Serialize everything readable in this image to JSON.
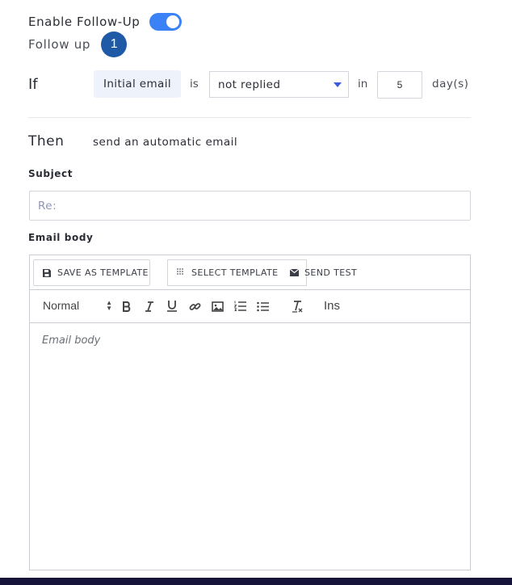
{
  "enable_followup": {
    "label": "Enable Follow-Up",
    "toggle_on": true,
    "accent": "#3b82f6"
  },
  "follow_up": {
    "label": "Follow up",
    "step": "1",
    "badge_color": "#1f5aa6"
  },
  "condition": {
    "if_label": "If",
    "trigger": "Initial email",
    "is_label": "is",
    "status_selected": "not replied",
    "in_label": "in",
    "days_value": "5",
    "days_unit": "day(s)"
  },
  "action": {
    "then_label": "Then",
    "text": "send an automatic email"
  },
  "subject": {
    "label": "Subject",
    "placeholder": "Re:"
  },
  "email_body": {
    "label": "Email body",
    "toolbar": {
      "save_template": "SAVE AS TEMPLATE",
      "select_template": "SELECT TEMPLATE",
      "send_test": "SEND TEST"
    },
    "format": {
      "text_style": "Normal",
      "insert_label": "Ins",
      "tools": [
        "bold-icon",
        "italic-icon",
        "underline-icon",
        "link-icon",
        "image-icon",
        "ordered-list-icon",
        "bullet-list-icon",
        "clear-format-icon"
      ]
    },
    "placeholder": "Email body"
  }
}
